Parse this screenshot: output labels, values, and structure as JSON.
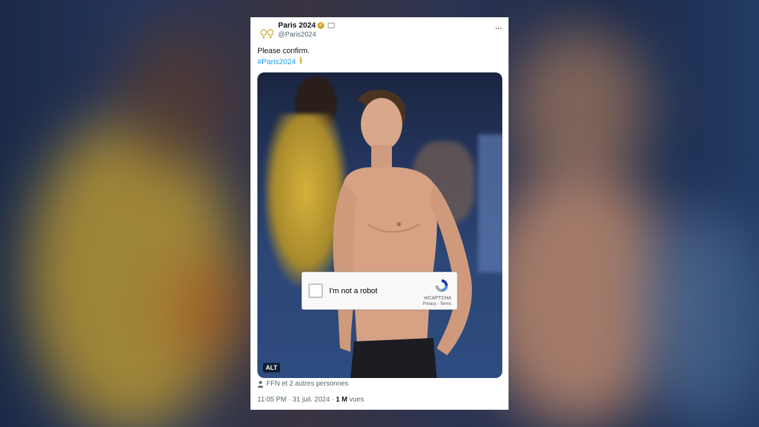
{
  "tweet": {
    "display_name": "Paris 2024",
    "handle": "@Paris2024",
    "text_line1": "Please confirm.",
    "hashtag": "#Paris2024",
    "more_menu": "···",
    "media": {
      "alt_badge": "ALT"
    },
    "captcha": {
      "label": "I'm not a robot",
      "brand": "reCAPTCHA",
      "links": "Privacy - Terms"
    },
    "tagged_people": "FFN et 2 autres personnes",
    "time": "11:05 PM",
    "sep1": " · ",
    "date": "31 juil. 2024",
    "sep2": " · ",
    "views_count": "1 M",
    "views_label": " vues"
  },
  "colors": {
    "accent": "#1d9bf0",
    "verified_badge": "#d4a52a",
    "recaptcha_blue": "#1c3aa9"
  },
  "icons": [
    "paris-2024-logo-icon",
    "verified-badge-icon",
    "affiliate-badge-icon",
    "more-icon",
    "torch-icon",
    "recaptcha-logo-icon",
    "person-icon"
  ]
}
